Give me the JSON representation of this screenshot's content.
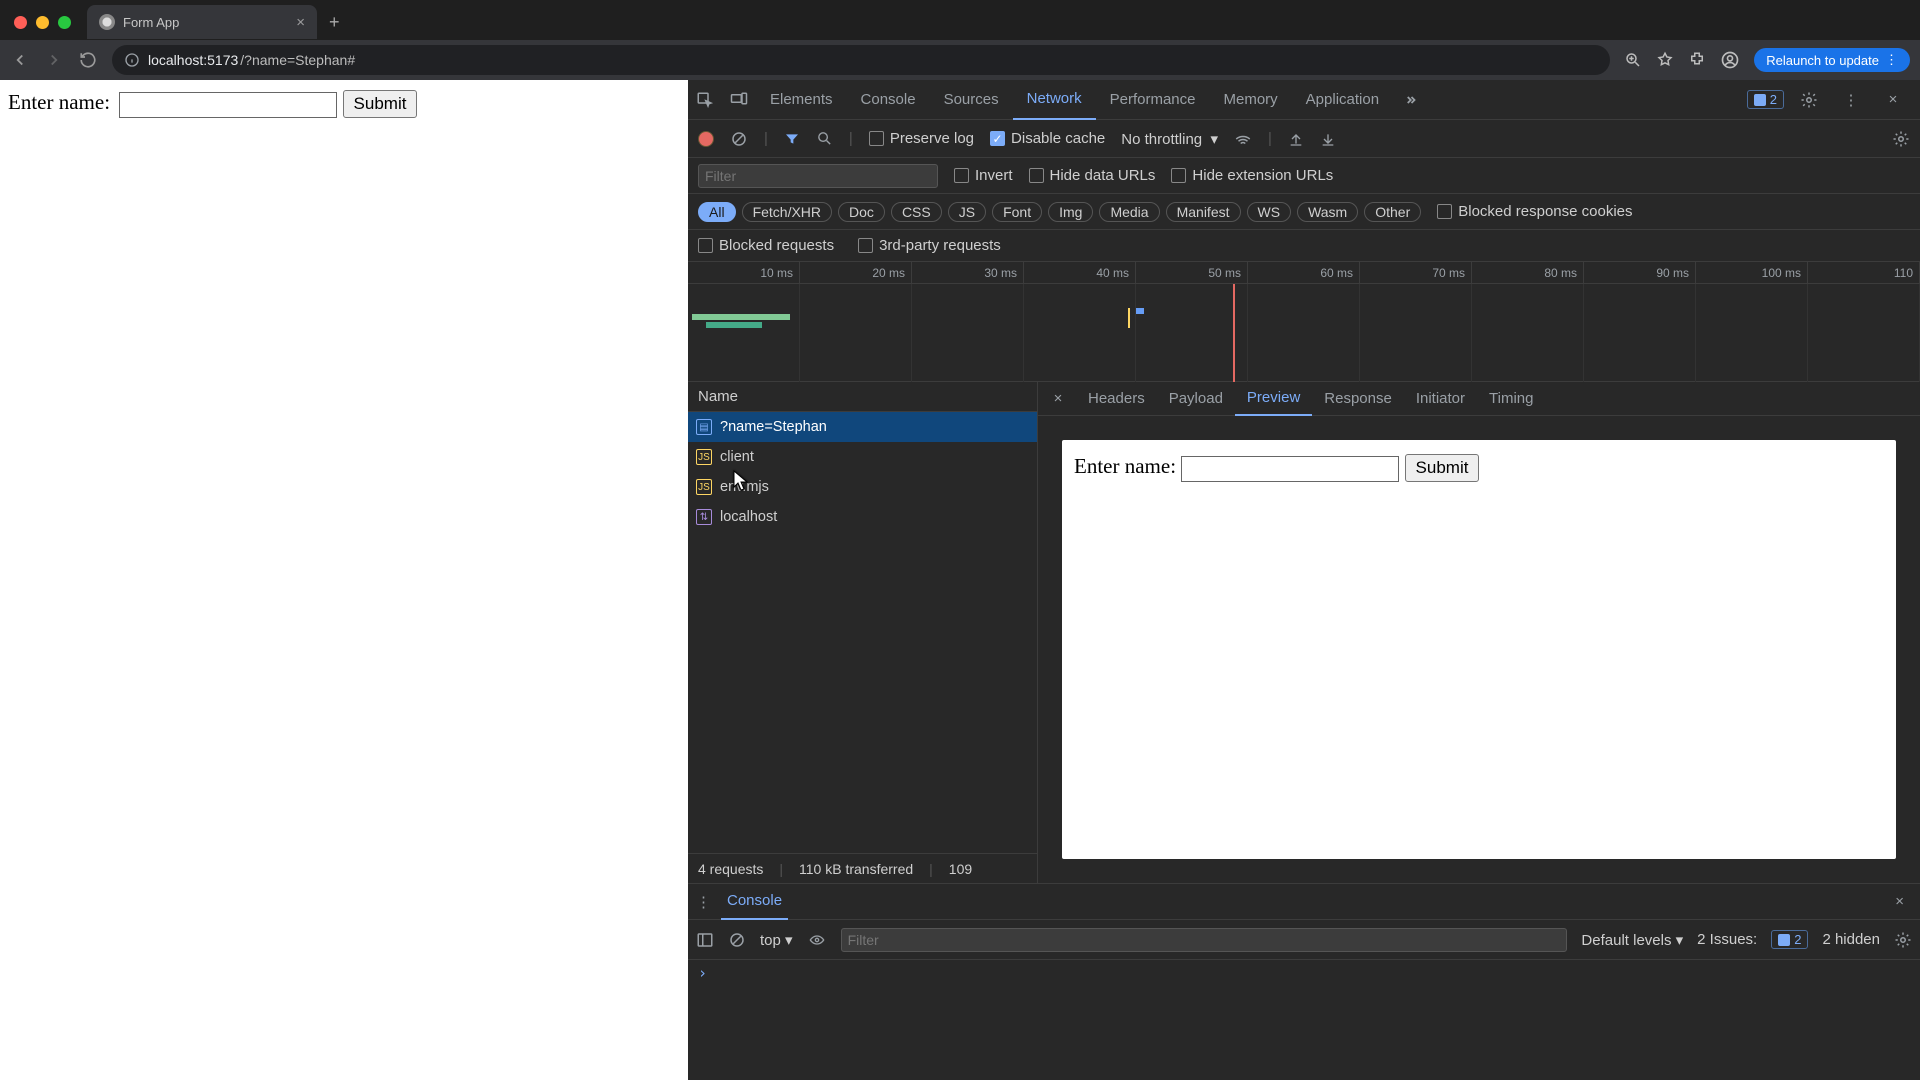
{
  "browser": {
    "tab_title": "Form App",
    "url_host": "localhost:5173",
    "url_path": "/?name=Stephan#",
    "relaunch": "Relaunch to update"
  },
  "page": {
    "label": "Enter name:",
    "submit": "Submit"
  },
  "devtools": {
    "tabs": [
      "Elements",
      "Console",
      "Sources",
      "Network",
      "Performance",
      "Memory",
      "Application"
    ],
    "active_tab": "Network",
    "issues_count": "2",
    "network": {
      "preserve_log": "Preserve log",
      "disable_cache": "Disable cache",
      "throttling": "No throttling",
      "filter_placeholder": "Filter",
      "invert": "Invert",
      "hide_data_urls": "Hide data URLs",
      "hide_ext_urls": "Hide extension URLs",
      "types": [
        "All",
        "Fetch/XHR",
        "Doc",
        "CSS",
        "JS",
        "Font",
        "Img",
        "Media",
        "Manifest",
        "WS",
        "Wasm",
        "Other"
      ],
      "blocked_cookies": "Blocked response cookies",
      "blocked_requests": "Blocked requests",
      "third_party": "3rd-party requests",
      "timeline_ticks": [
        "10 ms",
        "20 ms",
        "30 ms",
        "40 ms",
        "50 ms",
        "60 ms",
        "70 ms",
        "80 ms",
        "90 ms",
        "100 ms",
        "110"
      ],
      "columns": {
        "name": "Name"
      },
      "requests": [
        {
          "name": "?name=Stephan",
          "type": "doc",
          "selected": true
        },
        {
          "name": "client",
          "type": "js",
          "selected": false
        },
        {
          "name": "env.mjs",
          "type": "js",
          "selected": false
        },
        {
          "name": "localhost",
          "type": "ws",
          "selected": false
        }
      ],
      "status": {
        "requests": "4 requests",
        "transferred": "110 kB transferred",
        "resources": "109"
      },
      "detail_tabs": [
        "Headers",
        "Payload",
        "Preview",
        "Response",
        "Initiator",
        "Timing"
      ],
      "detail_active": "Preview",
      "preview": {
        "label": "Enter name:",
        "submit": "Submit"
      }
    },
    "console": {
      "title": "Console",
      "context": "top",
      "filter_placeholder": "Filter",
      "levels": "Default levels",
      "issues_label": "2 Issues:",
      "issues_count": "2",
      "hidden": "2 hidden",
      "prompt": "›"
    }
  }
}
